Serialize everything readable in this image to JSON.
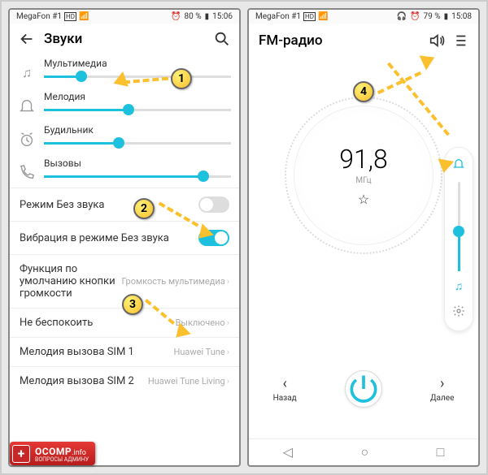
{
  "left": {
    "status": {
      "carrier": "MegaFon #1",
      "batt": "80 %",
      "time": "15:06"
    },
    "title": "Звуки",
    "sliders": [
      {
        "label": "Мультимедиа",
        "value": 20
      },
      {
        "label": "Мелодия",
        "value": 45
      },
      {
        "label": "Будильник",
        "value": 40
      },
      {
        "label": "Вызовы",
        "value": 85
      }
    ],
    "rows": {
      "silent": {
        "label": "Режим Без звука",
        "on": false
      },
      "vibrate": {
        "label": "Вибрация в режиме Без звука",
        "on": true
      },
      "volbtn": {
        "label": "Функция по умолчанию кнопки громкости",
        "value": "Громкость мультимедиа"
      },
      "dnd": {
        "label": "Не беспокоить",
        "value": "Выключено"
      },
      "sim1": {
        "label": "Мелодия вызова SIM 1",
        "value": "Huawei Tune"
      },
      "sim2": {
        "label": "Мелодия вызова SIM 2",
        "value": "Huawei Tune Living"
      }
    }
  },
  "right": {
    "status": {
      "carrier": "MegaFon #1",
      "batt": "79 %",
      "time": "15:08"
    },
    "title": "FM-радио",
    "freq": "91,8",
    "unit": "МГц",
    "prev": "Назад",
    "next": "Далее",
    "vol_value": 45
  },
  "annot": {
    "b1": "1",
    "b2": "2",
    "b3": "3",
    "b4": "4"
  },
  "watermark": {
    "main": "OCOMP",
    "info": ".info",
    "sub": "ВОПРОСЫ АДМИНУ"
  }
}
